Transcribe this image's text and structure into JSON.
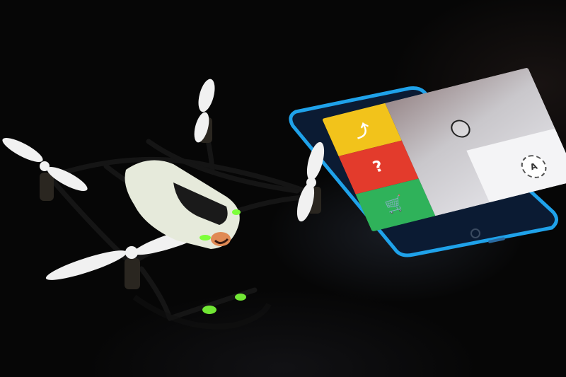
{
  "scene": {
    "description_hidden": "",
    "phone_screen": {
      "badge_text": "A"
    }
  },
  "colors": {
    "phone_frame": "#1fa2ea",
    "tile_yellow": "#f2c31b",
    "tile_red": "#e33b2c",
    "tile_green": "#2fb25a",
    "drone_body": "#e9ecd8",
    "drone_led": "#7dff3a"
  },
  "icons": {
    "tile_yellow": "share-icon",
    "tile_red": "question-icon",
    "tile_green": "cart-icon",
    "camera_play": "play-icon"
  }
}
